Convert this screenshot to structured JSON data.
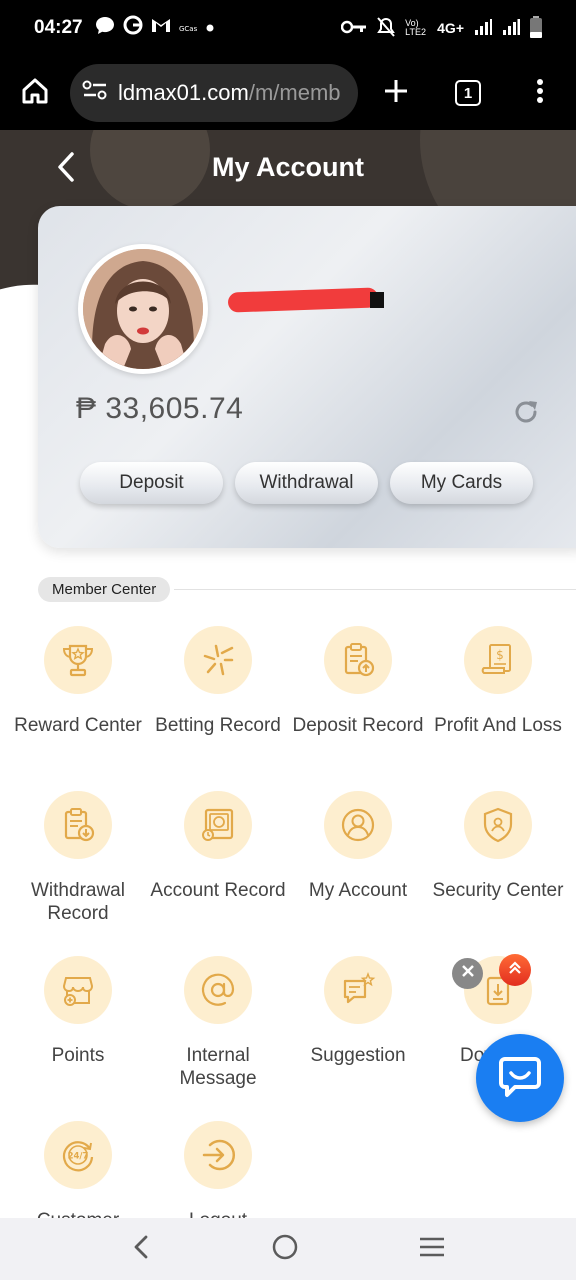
{
  "status_bar": {
    "time": "04:27",
    "network": "4G+",
    "volte": "Vo) LTE2"
  },
  "browser": {
    "url_host": "ldmax01.com",
    "url_path": "/m/memb",
    "tab_count": "1"
  },
  "page": {
    "title": "My Account"
  },
  "account": {
    "balance": "₱ 33,605.74",
    "buttons": [
      "Deposit",
      "Withdrawal",
      "My Cards"
    ]
  },
  "member_center": {
    "label": "Member Center",
    "items": [
      {
        "label": "Reward Center",
        "icon": "trophy-icon"
      },
      {
        "label": "Betting Record",
        "icon": "betting-icon"
      },
      {
        "label": "Deposit Record",
        "icon": "deposit-record-icon"
      },
      {
        "label": "Profit And Loss",
        "icon": "profit-loss-icon"
      },
      {
        "label": "Withdrawal Record",
        "icon": "withdrawal-record-icon"
      },
      {
        "label": "Account Record",
        "icon": "account-record-icon"
      },
      {
        "label": "My Account",
        "icon": "user-icon"
      },
      {
        "label": "Security Center",
        "icon": "shield-icon"
      },
      {
        "label": "Points",
        "icon": "store-icon"
      },
      {
        "label": "Internal Message",
        "icon": "at-icon"
      },
      {
        "label": "Suggestion",
        "icon": "suggestion-icon"
      },
      {
        "label": "Dov",
        "icon": "download-icon"
      },
      {
        "label": "Customer",
        "icon": "support-24-7-icon"
      },
      {
        "label": "Logout",
        "icon": "logout-icon"
      }
    ]
  },
  "colors": {
    "accent": "#e2a94a",
    "icon_bg": "#fdeecf",
    "chat_fab": "#1a7ef2"
  }
}
